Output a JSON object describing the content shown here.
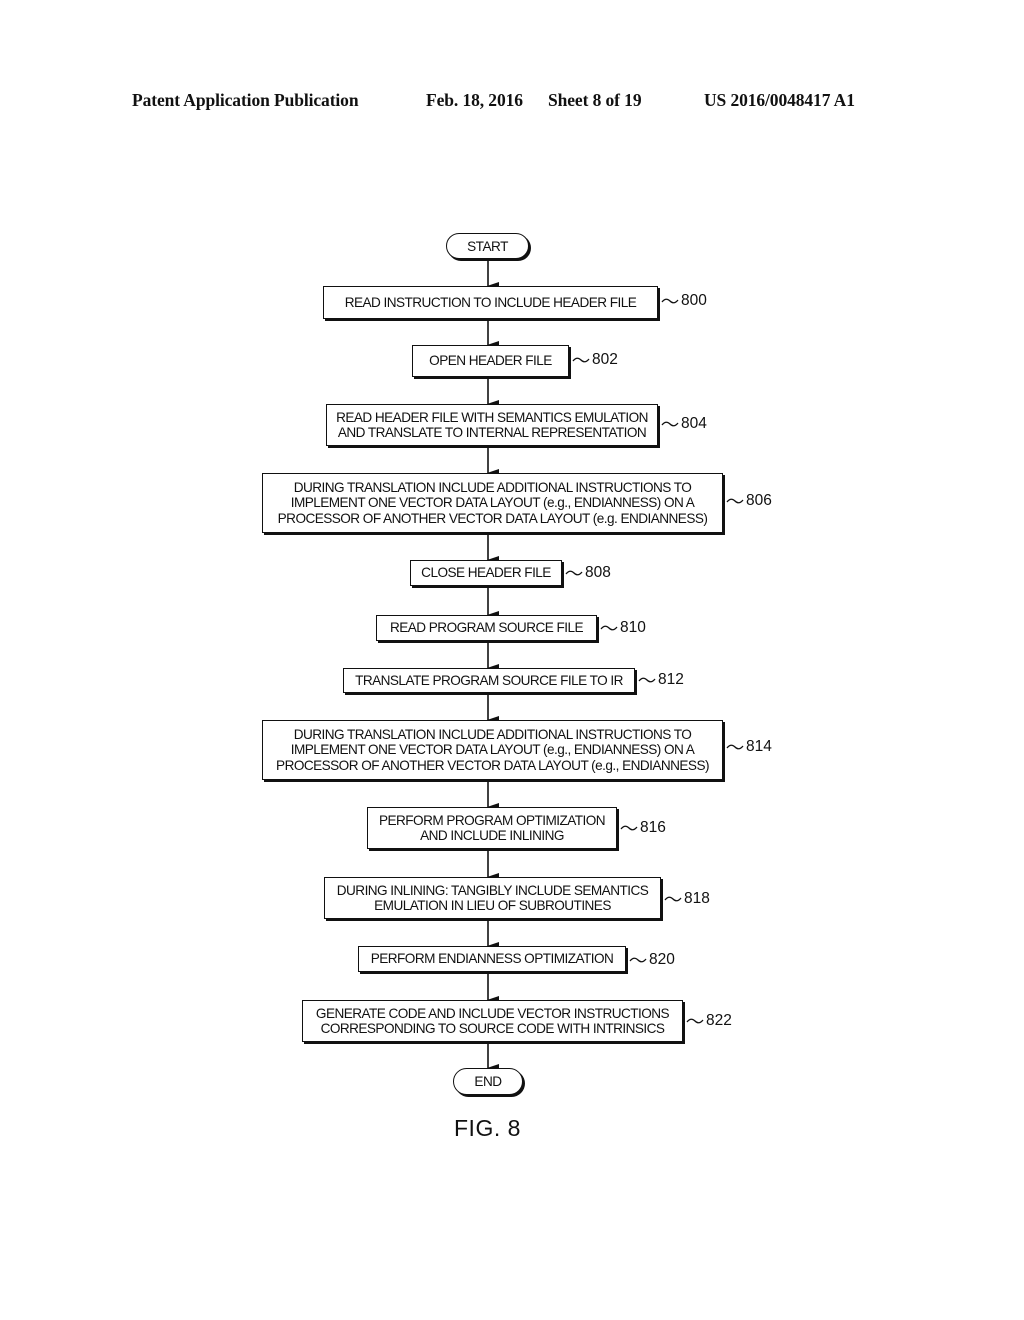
{
  "header": {
    "publication": "Patent Application Publication",
    "date": "Feb. 18, 2016",
    "sheet": "Sheet 8 of 19",
    "number": "US 2016/0048417 A1"
  },
  "flowchart": {
    "start": "START",
    "end": "END",
    "steps": [
      {
        "ref": "800",
        "text": "READ INSTRUCTION TO INCLUDE HEADER FILE"
      },
      {
        "ref": "802",
        "text": "OPEN HEADER FILE"
      },
      {
        "ref": "804",
        "text": "READ HEADER FILE WITH SEMANTICS EMULATION\nAND TRANSLATE TO INTERNAL REPRESENTATION"
      },
      {
        "ref": "806",
        "text": "DURING TRANSLATION INCLUDE ADDITIONAL INSTRUCTIONS TO\nIMPLEMENT ONE VECTOR DATA LAYOUT (e.g., ENDIANNESS) ON A\nPROCESSOR OF ANOTHER VECTOR DATA LAYOUT (e.g. ENDIANNESS)"
      },
      {
        "ref": "808",
        "text": "CLOSE HEADER FILE"
      },
      {
        "ref": "810",
        "text": "READ PROGRAM SOURCE FILE"
      },
      {
        "ref": "812",
        "text": "TRANSLATE PROGRAM SOURCE FILE TO IR"
      },
      {
        "ref": "814",
        "text": "DURING TRANSLATION INCLUDE ADDITIONAL INSTRUCTIONS TO\nIMPLEMENT ONE VECTOR DATA LAYOUT (e.g., ENDIANNESS) ON A\nPROCESSOR OF ANOTHER VECTOR DATA LAYOUT (e.g., ENDIANNESS)"
      },
      {
        "ref": "816",
        "text": "PERFORM PROGRAM OPTIMIZATION\nAND INCLUDE INLINING"
      },
      {
        "ref": "818",
        "text": "DURING INLINING: TANGIBLY INCLUDE SEMANTICS\nEMULATION IN LIEU OF SUBROUTINES"
      },
      {
        "ref": "820",
        "text": "PERFORM ENDIANNESS OPTIMIZATION"
      },
      {
        "ref": "822",
        "text": "GENERATE  CODE AND INCLUDE  VECTOR INSTRUCTIONS\nCORRESPONDING TO SOURCE CODE WITH INTRINSICS"
      }
    ]
  },
  "figure_label": "FIG. 8"
}
